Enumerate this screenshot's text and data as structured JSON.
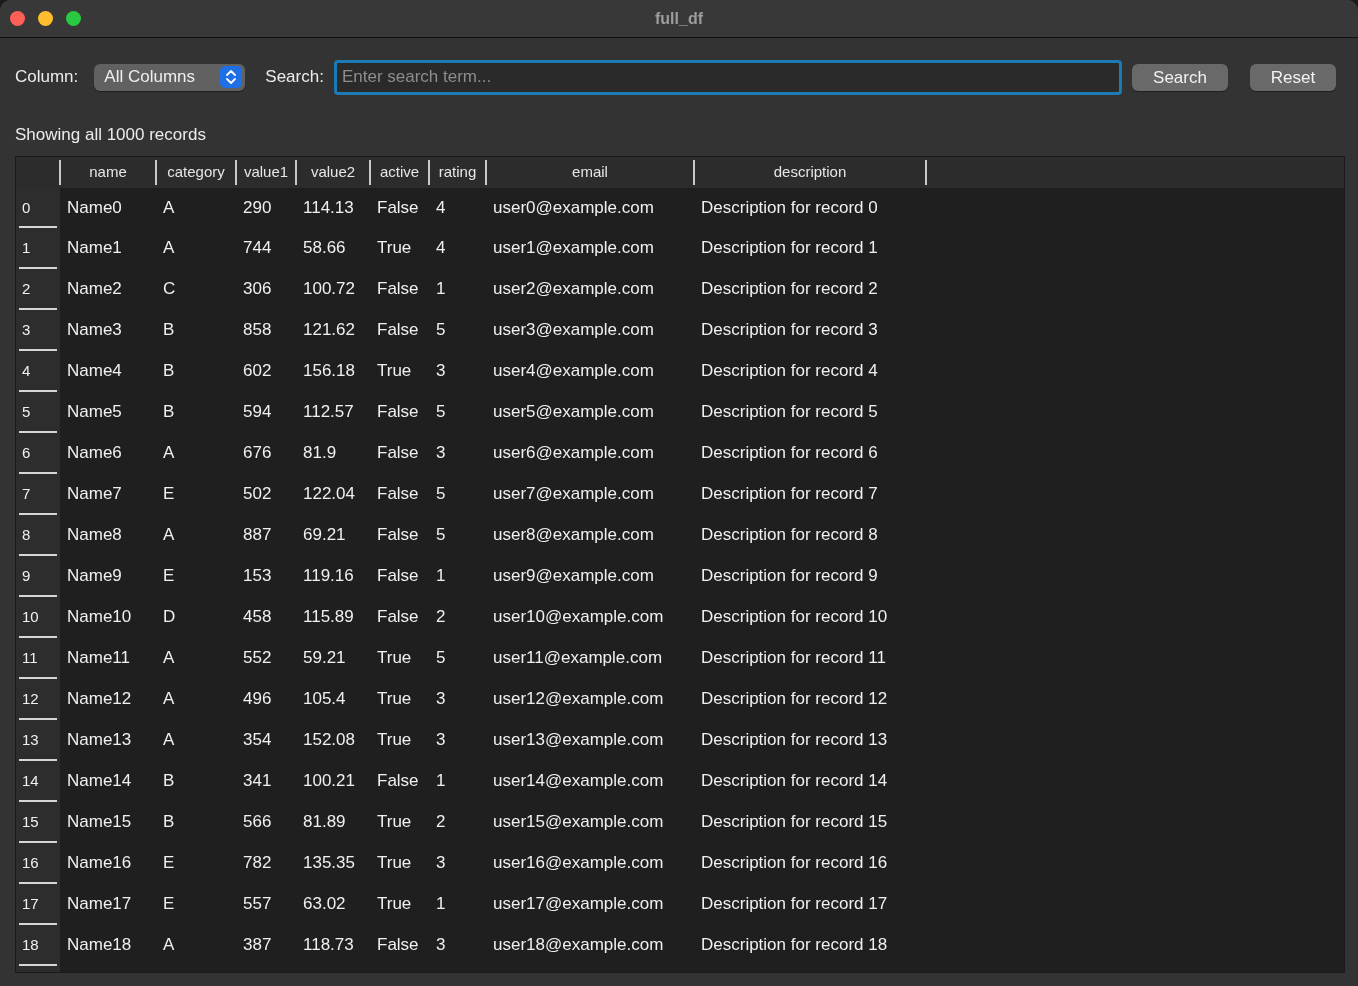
{
  "window": {
    "title": "full_df"
  },
  "toolbar": {
    "column_label": "Column:",
    "column_select": {
      "value": "All Columns"
    },
    "search_label": "Search:",
    "search_field": {
      "placeholder": "Enter search term...",
      "focused": true
    },
    "buttons": [
      "Search",
      "Reset"
    ]
  },
  "status": "Showing all 1000 records",
  "table": {
    "columns": [
      "name",
      "category",
      "value1",
      "value2",
      "active",
      "rating",
      "email",
      "description"
    ],
    "rows": [
      {
        "index": "0",
        "cells": [
          "Name0",
          "A",
          "290",
          "114.13",
          "False",
          "4",
          "user0@example.com",
          "Description for record 0"
        ]
      },
      {
        "index": "1",
        "cells": [
          "Name1",
          "A",
          "744",
          "58.66",
          "True",
          "4",
          "user1@example.com",
          "Description for record 1"
        ]
      },
      {
        "index": "2",
        "cells": [
          "Name2",
          "C",
          "306",
          "100.72",
          "False",
          "1",
          "user2@example.com",
          "Description for record 2"
        ]
      },
      {
        "index": "3",
        "cells": [
          "Name3",
          "B",
          "858",
          "121.62",
          "False",
          "5",
          "user3@example.com",
          "Description for record 3"
        ]
      },
      {
        "index": "4",
        "cells": [
          "Name4",
          "B",
          "602",
          "156.18",
          "True",
          "3",
          "user4@example.com",
          "Description for record 4"
        ]
      },
      {
        "index": "5",
        "cells": [
          "Name5",
          "B",
          "594",
          "112.57",
          "False",
          "5",
          "user5@example.com",
          "Description for record 5"
        ]
      },
      {
        "index": "6",
        "cells": [
          "Name6",
          "A",
          "676",
          "81.9",
          "False",
          "3",
          "user6@example.com",
          "Description for record 6"
        ]
      },
      {
        "index": "7",
        "cells": [
          "Name7",
          "E",
          "502",
          "122.04",
          "False",
          "5",
          "user7@example.com",
          "Description for record 7"
        ]
      },
      {
        "index": "8",
        "cells": [
          "Name8",
          "A",
          "887",
          "69.21",
          "False",
          "5",
          "user8@example.com",
          "Description for record 8"
        ]
      },
      {
        "index": "9",
        "cells": [
          "Name9",
          "E",
          "153",
          "119.16",
          "False",
          "1",
          "user9@example.com",
          "Description for record 9"
        ]
      },
      {
        "index": "10",
        "cells": [
          "Name10",
          "D",
          "458",
          "115.89",
          "False",
          "2",
          "user10@example.com",
          "Description for record 10"
        ]
      },
      {
        "index": "11",
        "cells": [
          "Name11",
          "A",
          "552",
          "59.21",
          "True",
          "5",
          "user11@example.com",
          "Description for record 11"
        ]
      },
      {
        "index": "12",
        "cells": [
          "Name12",
          "A",
          "496",
          "105.4",
          "True",
          "3",
          "user12@example.com",
          "Description for record 12"
        ]
      },
      {
        "index": "13",
        "cells": [
          "Name13",
          "A",
          "354",
          "152.08",
          "True",
          "3",
          "user13@example.com",
          "Description for record 13"
        ]
      },
      {
        "index": "14",
        "cells": [
          "Name14",
          "B",
          "341",
          "100.21",
          "False",
          "1",
          "user14@example.com",
          "Description for record 14"
        ]
      },
      {
        "index": "15",
        "cells": [
          "Name15",
          "B",
          "566",
          "81.89",
          "True",
          "2",
          "user15@example.com",
          "Description for record 15"
        ]
      },
      {
        "index": "16",
        "cells": [
          "Name16",
          "E",
          "782",
          "135.35",
          "True",
          "3",
          "user16@example.com",
          "Description for record 16"
        ]
      },
      {
        "index": "17",
        "cells": [
          "Name17",
          "E",
          "557",
          "63.02",
          "True",
          "1",
          "user17@example.com",
          "Description for record 17"
        ]
      },
      {
        "index": "18",
        "cells": [
          "Name18",
          "A",
          "387",
          "118.73",
          "False",
          "3",
          "user18@example.com",
          "Description for record 18"
        ]
      }
    ]
  }
}
